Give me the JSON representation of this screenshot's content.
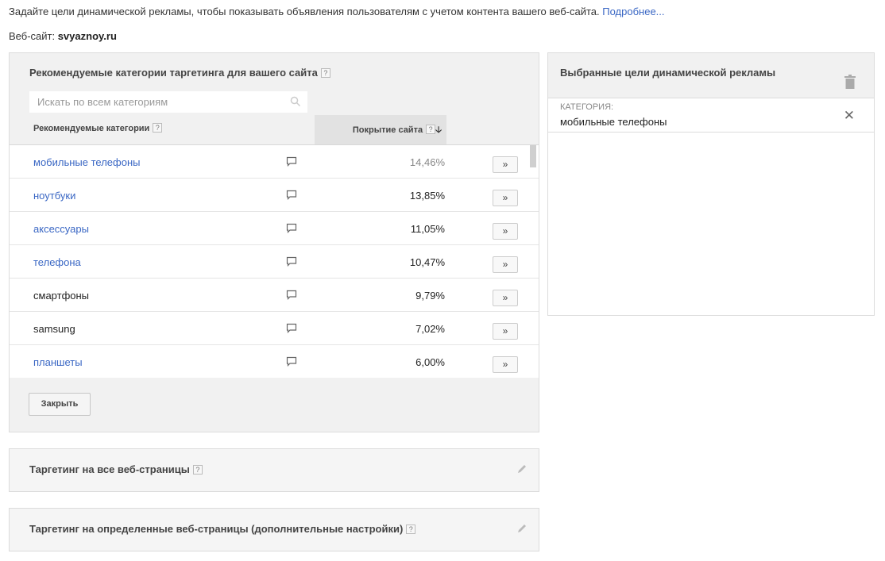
{
  "intro": {
    "text": "Задайте цели динамической рекламы, чтобы показывать объявления пользователям с учетом контента вашего веб-сайта. ",
    "link": "Подробнее..."
  },
  "website": {
    "label": "Веб-сайт: ",
    "value": "svyaznoy.ru"
  },
  "recommended": {
    "title": "Рекомендуемые категории таргетинга для вашего сайта",
    "search_placeholder": "Искать по всем категориям",
    "col_categories": "Рекомендуемые категории",
    "col_coverage": "Покрытие сайта",
    "add_label": "»",
    "rows": [
      {
        "name": "мобильные телефоны",
        "coverage": "14,46%",
        "is_link": true,
        "dim": true
      },
      {
        "name": "ноутбуки",
        "coverage": "13,85%",
        "is_link": true,
        "dim": false
      },
      {
        "name": "аксессуары",
        "coverage": "11,05%",
        "is_link": true,
        "dim": false
      },
      {
        "name": "телефона",
        "coverage": "10,47%",
        "is_link": true,
        "dim": false
      },
      {
        "name": "смартфоны",
        "coverage": "9,79%",
        "is_link": false,
        "dim": false
      },
      {
        "name": "samsung",
        "coverage": "7,02%",
        "is_link": false,
        "dim": false
      },
      {
        "name": "планшеты",
        "coverage": "6,00%",
        "is_link": true,
        "dim": false
      }
    ],
    "close_label": "Закрыть"
  },
  "selected": {
    "title": "Выбранные цели динамической рекламы",
    "items": [
      {
        "label": "КАТЕГОРИЯ:",
        "value": "мобильные телефоны"
      }
    ]
  },
  "sections": {
    "all_pages": "Таргетинг на все веб-страницы",
    "specific_pages": "Таргетинг на определенные веб-страницы (дополнительные настройки)"
  },
  "colors": {
    "link": "#3a67c4",
    "panel_bg": "#f1f1f1",
    "border": "#dcdcdc"
  }
}
